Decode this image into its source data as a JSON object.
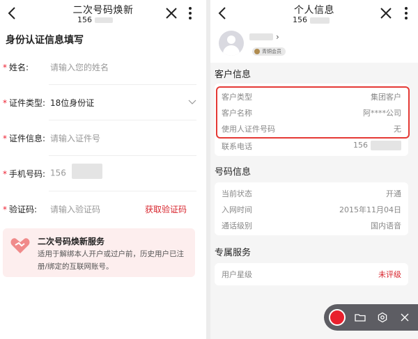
{
  "left": {
    "header": {
      "title": "二次号码焕新",
      "subtitle_prefix": "156"
    },
    "section_title": "身份认证信息填写",
    "fields": [
      {
        "label": "姓名:",
        "placeholder": "请输入您的姓名"
      },
      {
        "label": "证件类型:",
        "value": "18位身份证"
      },
      {
        "label": "证件信息:",
        "placeholder": "请输入证件号"
      },
      {
        "label": "手机号码:",
        "value": "156"
      },
      {
        "label": "验证码:",
        "placeholder": "请输入验证码",
        "action": "获取验证码"
      }
    ],
    "promo": {
      "title": "二次号码焕新服务",
      "description": "适用于解绑本人开户或过户前，历史用户已注册/绑定的互联网账号。"
    }
  },
  "right": {
    "header": {
      "title": "个人信息",
      "subtitle_prefix": "156"
    },
    "profile": {
      "arrow": "›",
      "badge": "青铜会员"
    },
    "customer_section": {
      "title": "客户信息",
      "rows": [
        {
          "key": "客户类型",
          "value": "集团客户"
        },
        {
          "key": "客户名称",
          "value": "阿****公司"
        },
        {
          "key": "使用人证件号码",
          "value": "无"
        },
        {
          "key": "联系电话",
          "value": "156"
        }
      ]
    },
    "number_section": {
      "title": "号码信息",
      "rows": [
        {
          "key": "当前状态",
          "value": "开通"
        },
        {
          "key": "入网时间",
          "value": "2015年11月04日"
        },
        {
          "key": "通话级别",
          "value": "国内语音"
        }
      ]
    },
    "service_section": {
      "title": "专属服务",
      "rows": [
        {
          "key": "用户星级",
          "value": "未评级"
        }
      ]
    }
  },
  "colors": {
    "accent": "#d8262e",
    "highlight": "#e53935",
    "record": "#e8202d"
  },
  "icons": [
    "back-icon",
    "close-icon",
    "more-icon",
    "chevron-down-icon",
    "heart-handshake-icon",
    "record-icon",
    "folder-icon",
    "settings-icon",
    "close-icon"
  ]
}
